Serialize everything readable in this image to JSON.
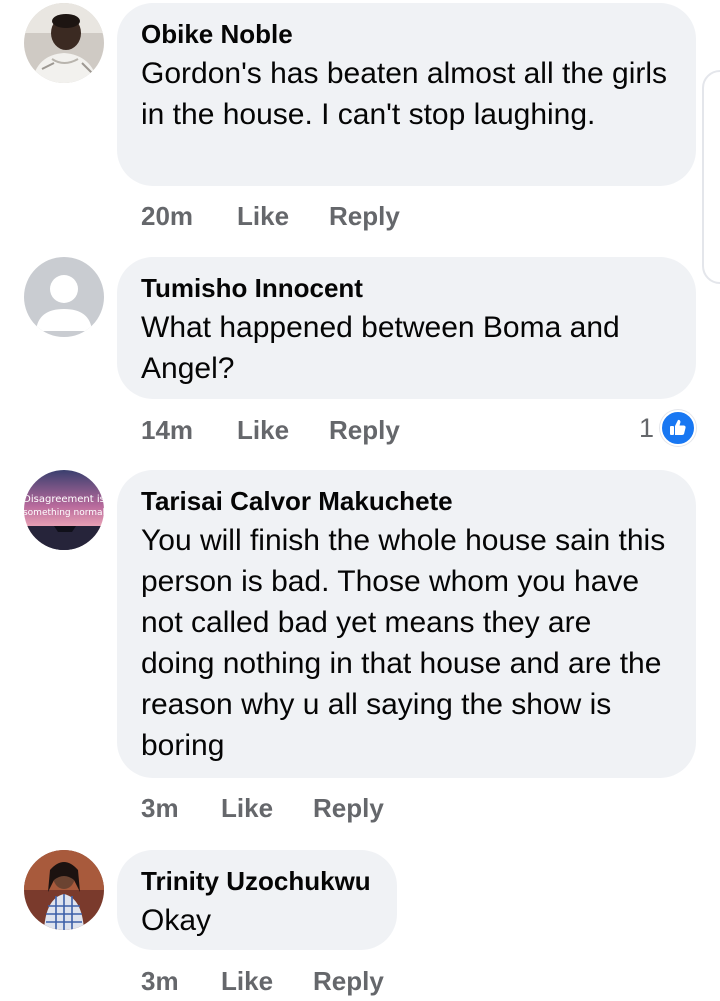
{
  "comments": [
    {
      "author": "Obike Noble",
      "text": "Gordon's has beaten almost all the girls in the house. I can't stop laughing.",
      "time": "20m",
      "like_label": "Like",
      "reply_label": "Reply",
      "avatar": "user-photo"
    },
    {
      "author": "Tumisho Innocent",
      "text": "What happened between Boma and Angel?",
      "time": "14m",
      "like_label": "Like",
      "reply_label": "Reply",
      "reaction_count": "1",
      "reaction_icon": "thumbs-up-icon",
      "avatar": "default-profile-silhouette"
    },
    {
      "author": "Tarisai Calvor Makuchete",
      "text": "You will finish the whole house sain this person is bad. Those whom you have not called bad yet means they are doing nothing in that house and are the reason why u all saying the show is boring",
      "time": "3m",
      "like_label": "Like",
      "reply_label": "Reply",
      "avatar": "sunset-sea-photo",
      "avatar_text_line1": "Disagreement is",
      "avatar_text_line2": "something normal"
    },
    {
      "author": "Trinity Uzochukwu",
      "text": "Okay",
      "time": "3m",
      "like_label": "Like",
      "reply_label": "Reply",
      "avatar": "user-photo"
    }
  ],
  "colors": {
    "bubble": "#f0f2f5",
    "meta_text": "#65676b",
    "like_blue": "#1877f2"
  }
}
